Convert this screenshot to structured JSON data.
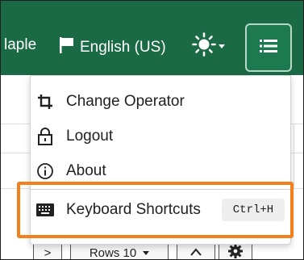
{
  "header": {
    "user_name": "laple",
    "language_label": "English (US)",
    "theme_icon": "sun-icon",
    "menu_icon": "hamburger-list-icon"
  },
  "menu": {
    "items": [
      {
        "label": "Change Operator",
        "icon": "crop-swap-icon"
      },
      {
        "label": "Logout",
        "icon": "lock-icon"
      },
      {
        "label": "About",
        "icon": "info-icon"
      },
      {
        "label": "Keyboard Shortcuts",
        "icon": "keyboard-icon",
        "shortcut": "Ctrl+H"
      }
    ]
  },
  "toolbar": {
    "next_label": ">",
    "rows_label": "Rows 10"
  },
  "colors": {
    "header_bg": "#196a45",
    "highlight": "#f07f1c"
  }
}
